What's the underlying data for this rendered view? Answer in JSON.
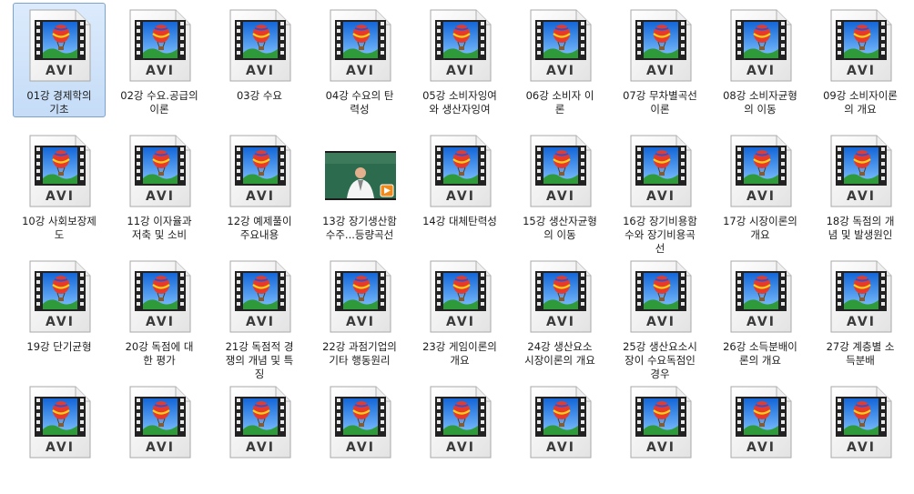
{
  "window": {
    "selected_index": 0
  },
  "files": [
    {
      "label": "01강 경제학의\n기초",
      "icon": "avi-file-icon"
    },
    {
      "label": "02강 수요.공급의\n이론",
      "icon": "avi-file-icon"
    },
    {
      "label": "03강 수요",
      "icon": "avi-file-icon"
    },
    {
      "label": "04강 수요의 탄\n력성",
      "icon": "avi-file-icon"
    },
    {
      "label": "05강 소비자잉여\n와 생산자잉여",
      "icon": "avi-file-icon"
    },
    {
      "label": "06강 소비자 이\n론",
      "icon": "avi-file-icon"
    },
    {
      "label": "07강 무차별곡선\n이론",
      "icon": "avi-file-icon"
    },
    {
      "label": "08강 소비자균형\n의 이동",
      "icon": "avi-file-icon"
    },
    {
      "label": "09강 소비자이론\n의 개요",
      "icon": "avi-file-icon"
    },
    {
      "label": "10강 사회보장제\n도",
      "icon": "avi-file-icon"
    },
    {
      "label": "11강 이자율과\n저축 및 소비",
      "icon": "avi-file-icon"
    },
    {
      "label": "12강 예제풀이\n주요내용",
      "icon": "avi-file-icon"
    },
    {
      "label": "13강 장기생산함\n수주...등량곡선",
      "icon": "video-thumbnail-icon"
    },
    {
      "label": "14강 대체탄력성",
      "icon": "avi-file-icon"
    },
    {
      "label": "15강 생산자균형\n의 이동",
      "icon": "avi-file-icon"
    },
    {
      "label": "16강 장기비용함\n수와 장기비용곡\n선",
      "icon": "avi-file-icon"
    },
    {
      "label": "17강 시장이론의\n개요",
      "icon": "avi-file-icon"
    },
    {
      "label": "18강 독점의 개\n념 및 발생원인",
      "icon": "avi-file-icon"
    },
    {
      "label": "19강 단기균형",
      "icon": "avi-file-icon"
    },
    {
      "label": "20강 독점에 대\n한 평가",
      "icon": "avi-file-icon"
    },
    {
      "label": "21강 독점적 경\n쟁의 개념 및 특\n징",
      "icon": "avi-file-icon"
    },
    {
      "label": "22강 과점기업의\n기타 행동원리",
      "icon": "avi-file-icon"
    },
    {
      "label": "23강 게임이론의\n개요",
      "icon": "avi-file-icon"
    },
    {
      "label": "24강 생산요소\n시장이론의 개요",
      "icon": "avi-file-icon"
    },
    {
      "label": "25강 생산요소시\n장이 수요독점인\n경우",
      "icon": "avi-file-icon"
    },
    {
      "label": "26강 소득분배이\n론의 개요",
      "icon": "avi-file-icon"
    },
    {
      "label": "27강 계층별 소\n득분배",
      "icon": "avi-file-icon"
    },
    {
      "label": "",
      "icon": "avi-file-icon"
    },
    {
      "label": "",
      "icon": "avi-file-icon"
    },
    {
      "label": "",
      "icon": "avi-file-icon"
    },
    {
      "label": "",
      "icon": "avi-file-icon"
    },
    {
      "label": "",
      "icon": "avi-file-icon"
    },
    {
      "label": "",
      "icon": "avi-file-icon"
    },
    {
      "label": "",
      "icon": "avi-file-icon"
    },
    {
      "label": "",
      "icon": "avi-file-icon"
    },
    {
      "label": "",
      "icon": "avi-file-icon"
    }
  ],
  "avi_badge": "AVI",
  "colors": {
    "selection": "#cce0f7",
    "badge": "#3a3a3a"
  }
}
